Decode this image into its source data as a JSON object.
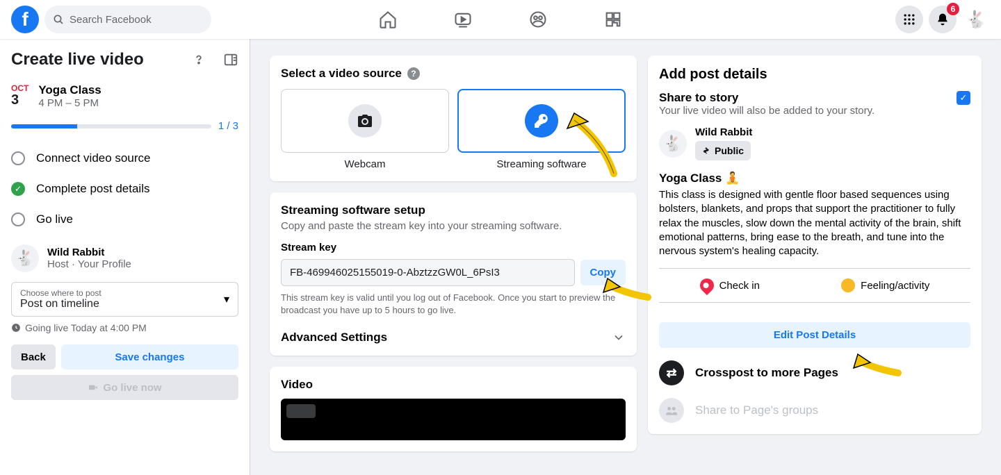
{
  "topnav": {
    "search_placeholder": "Search Facebook",
    "notifications_badge": "6"
  },
  "sidebar": {
    "title": "Create live video",
    "event": {
      "month": "OCT",
      "day": "3",
      "name": "Yoga Class",
      "time": "4 PM – 5 PM"
    },
    "progress": "1 / 3",
    "steps": [
      {
        "label": "Connect video source",
        "state": "pending"
      },
      {
        "label": "Complete post details",
        "state": "done"
      },
      {
        "label": "Go live",
        "state": "pending"
      }
    ],
    "profile": {
      "name": "Wild Rabbit",
      "sub": "Host · Your Profile"
    },
    "post_selector": {
      "label": "Choose where to post",
      "value": "Post on timeline"
    },
    "golive_time": "Going live Today at 4:00 PM",
    "back": "Back",
    "save": "Save changes",
    "golive_btn": "Go live now"
  },
  "source": {
    "title": "Select a video source",
    "webcam": "Webcam",
    "streaming": "Streaming software"
  },
  "setup": {
    "title": "Streaming software setup",
    "sub": "Copy and paste the stream key into your streaming software.",
    "key_label": "Stream key",
    "key_value": "FB-469946025155019-0-AbztzzGW0L_6PsI3",
    "copy": "Copy",
    "note": "This stream key is valid until you log out of Facebook. Once you start to preview the broadcast you have up to 5 hours to go live.",
    "advanced": "Advanced Settings"
  },
  "video_title": "Video",
  "details": {
    "title": "Add post details",
    "share_title": "Share to story",
    "share_sub": "Your live video will also be added to your story.",
    "author": "Wild Rabbit",
    "privacy": "Public",
    "post_title": "Yoga Class 🧘",
    "post_body": "This class is designed with gentle floor based sequences using bolsters, blankets, and props that support the practitioner to fully relax the muscles, slow down the mental activity of the brain, shift emotional patterns, bring ease to the breath, and tune into the nervous system's healing capacity.",
    "checkin": "Check in",
    "feeling": "Feeling/activity",
    "edit": "Edit Post Details",
    "crosspost": "Crosspost to more Pages",
    "share_groups": "Share to Page's groups"
  }
}
